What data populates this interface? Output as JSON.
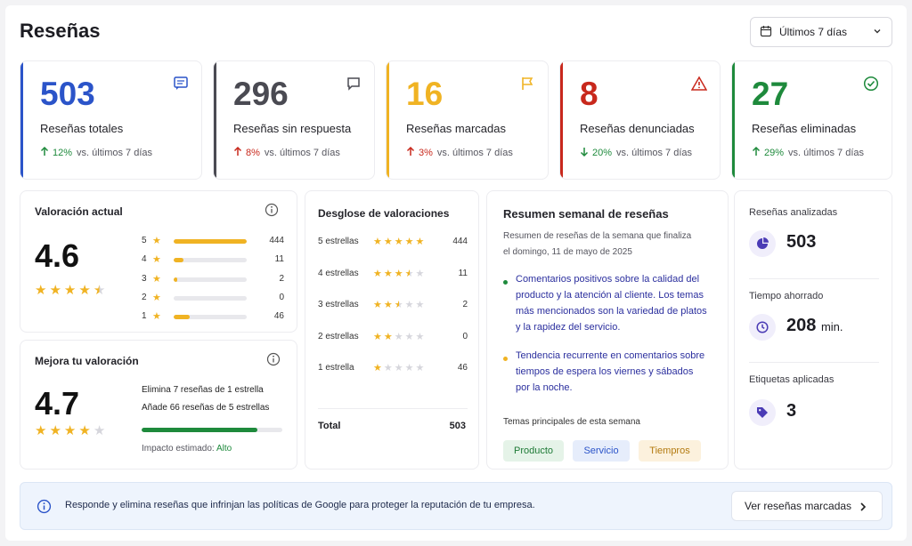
{
  "header": {
    "title": "Reseñas",
    "date_range": "Últimos 7 días",
    "calendar_icon": "calendar-icon",
    "chevron_icon": "chevron-down-icon"
  },
  "colors": {
    "blue": "#2b54c9",
    "gray": "#4a4a52",
    "yellow": "#f0b323",
    "red": "#c8281c",
    "green": "#1e8a3c",
    "star": "#f0b323"
  },
  "kpis": [
    {
      "value": "503",
      "label": "Reseñas totales",
      "pct": "12%",
      "trend": "up",
      "compare": "vs. últimos 7 días",
      "icon": "message-square-icon",
      "color": "#2b54c9"
    },
    {
      "value": "296",
      "label": "Reseñas sin respuesta",
      "pct": "8%",
      "trend": "up",
      "compare": "vs. últimos 7 días",
      "icon": "message-circle-icon",
      "color": "#4a4a52"
    },
    {
      "value": "16",
      "label": "Reseñas marcadas",
      "pct": "3%",
      "trend": "up",
      "compare": "vs. últimos 7 días",
      "icon": "flag-icon",
      "color": "#f0b323"
    },
    {
      "value": "8",
      "label": "Reseñas denunciadas",
      "pct": "20%",
      "trend": "down",
      "compare": "vs. últimos 7 días",
      "icon": "warning-icon",
      "color": "#c8281c"
    },
    {
      "value": "27",
      "label": "Reseñas eliminadas",
      "pct": "29%",
      "trend": "up",
      "compare": "vs. últimos 7 días",
      "icon": "check-circle-icon",
      "color": "#1e8a3c"
    }
  ],
  "current_rating": {
    "title": "Valoración actual",
    "value": "4.6",
    "stars": 4.5,
    "rows": [
      {
        "star": "5",
        "count": "444",
        "fraction": 1.0
      },
      {
        "star": "4",
        "count": "11",
        "fraction": 0.13
      },
      {
        "star": "3",
        "count": "2",
        "fraction": 0.05
      },
      {
        "star": "2",
        "count": "0",
        "fraction": 0.0
      },
      {
        "star": "1",
        "count": "46",
        "fraction": 0.22
      }
    ]
  },
  "improve": {
    "title": "Mejora tu valoración",
    "value": "4.7",
    "stars": 4,
    "line1": "Elimina 7 reseñas de 1 estrella",
    "line2": "Añade 66 reseñas de 5 estrellas",
    "progress": 0.82,
    "impact_label": "Impacto estimado:",
    "impact_value": "Alto"
  },
  "breakdown": {
    "title": "Desglose de valoraciones",
    "rows": [
      {
        "label": "5 estrellas",
        "stars": 5,
        "count": "444"
      },
      {
        "label": "4 estrellas",
        "stars": 3.5,
        "count": "11"
      },
      {
        "label": "3 estrellas",
        "stars": 2.5,
        "count": "2"
      },
      {
        "label": "2 estrellas",
        "stars": 2,
        "count": "0"
      },
      {
        "label": "1 estrella",
        "stars": 1,
        "count": "46"
      }
    ],
    "total_label": "Total",
    "total_value": "503"
  },
  "summary": {
    "title": "Resumen semanal de reseñas",
    "subtitle_1": "Resumen de reseñas de la semana que finaliza",
    "subtitle_2": "el domingo, 11 de mayo de 2025",
    "bullet1": [
      "Comentarios positivos sobre la calidad del",
      "producto y la atención al cliente. Los temas",
      "más mencionados son la variedad de platos",
      "y la rapidez del servicio."
    ],
    "bullet2": [
      "Tendencia recurrente en comentarios sobre",
      "tiempos de espera los viernes y sábados",
      "por la noche."
    ],
    "topics_title": "Temas principales de esta semana",
    "topics": [
      "Producto",
      "Servicio",
      "Tiempros"
    ]
  },
  "metrics": {
    "analyzed_label": "Reseñas analizadas",
    "analyzed_value": "503",
    "saved_label": "Tiempo ahorrado",
    "saved_value": "208",
    "saved_unit": "min.",
    "tags_label": "Etiquetas aplicadas",
    "tags_value": "3"
  },
  "banner": {
    "text": "Responde y elimina reseñas que infrinjan las políticas de Google para proteger la reputación de tu empresa.",
    "button": "Ver reseñas marcadas"
  }
}
